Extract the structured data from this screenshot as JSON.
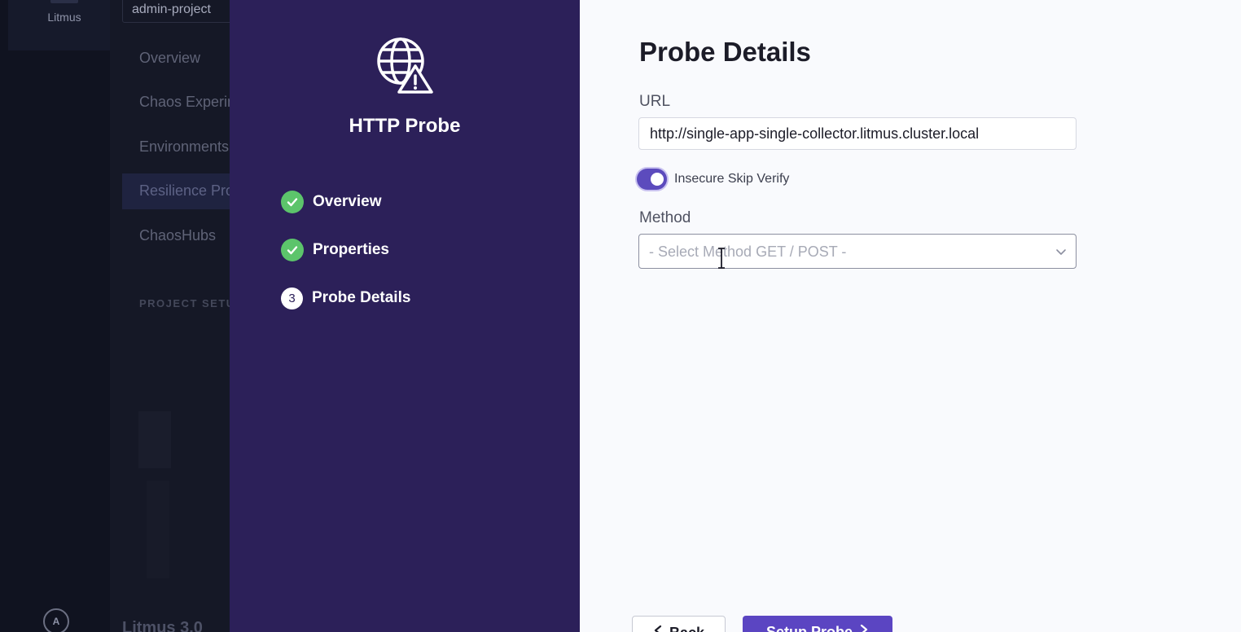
{
  "app": {
    "rail_label": "Litmus",
    "avatar_initial": "A",
    "project": "admin-project",
    "nav": [
      {
        "label": "Overview"
      },
      {
        "label": "Chaos Experiments"
      },
      {
        "label": "Environments"
      },
      {
        "label": "Resilience Probes",
        "active": true
      },
      {
        "label": "ChaosHubs"
      }
    ],
    "section_label": "PROJECT SETUP",
    "footer": "Litmus 3.0"
  },
  "wizard": {
    "icon": "globe-warning-icon",
    "title": "HTTP Probe",
    "steps": [
      {
        "label": "Overview",
        "state": "done",
        "icon": "check-icon"
      },
      {
        "label": "Properties",
        "state": "done",
        "icon": "check-icon"
      },
      {
        "label": "Probe Details",
        "state": "current",
        "number": "3"
      }
    ]
  },
  "form": {
    "heading": "Probe Details",
    "url_label": "URL",
    "url_value": "http://single-app-single-collector.litmus.cluster.local",
    "insecure_label": "Insecure Skip Verify",
    "insecure_enabled": true,
    "method_label": "Method",
    "method_placeholder": "- Select Method GET / POST -",
    "back_label": "Back",
    "submit_label": "Setup Probe"
  },
  "colors": {
    "wizard_bg": "#2c2059",
    "accent": "#5b45c2",
    "success": "#5cc46b"
  }
}
